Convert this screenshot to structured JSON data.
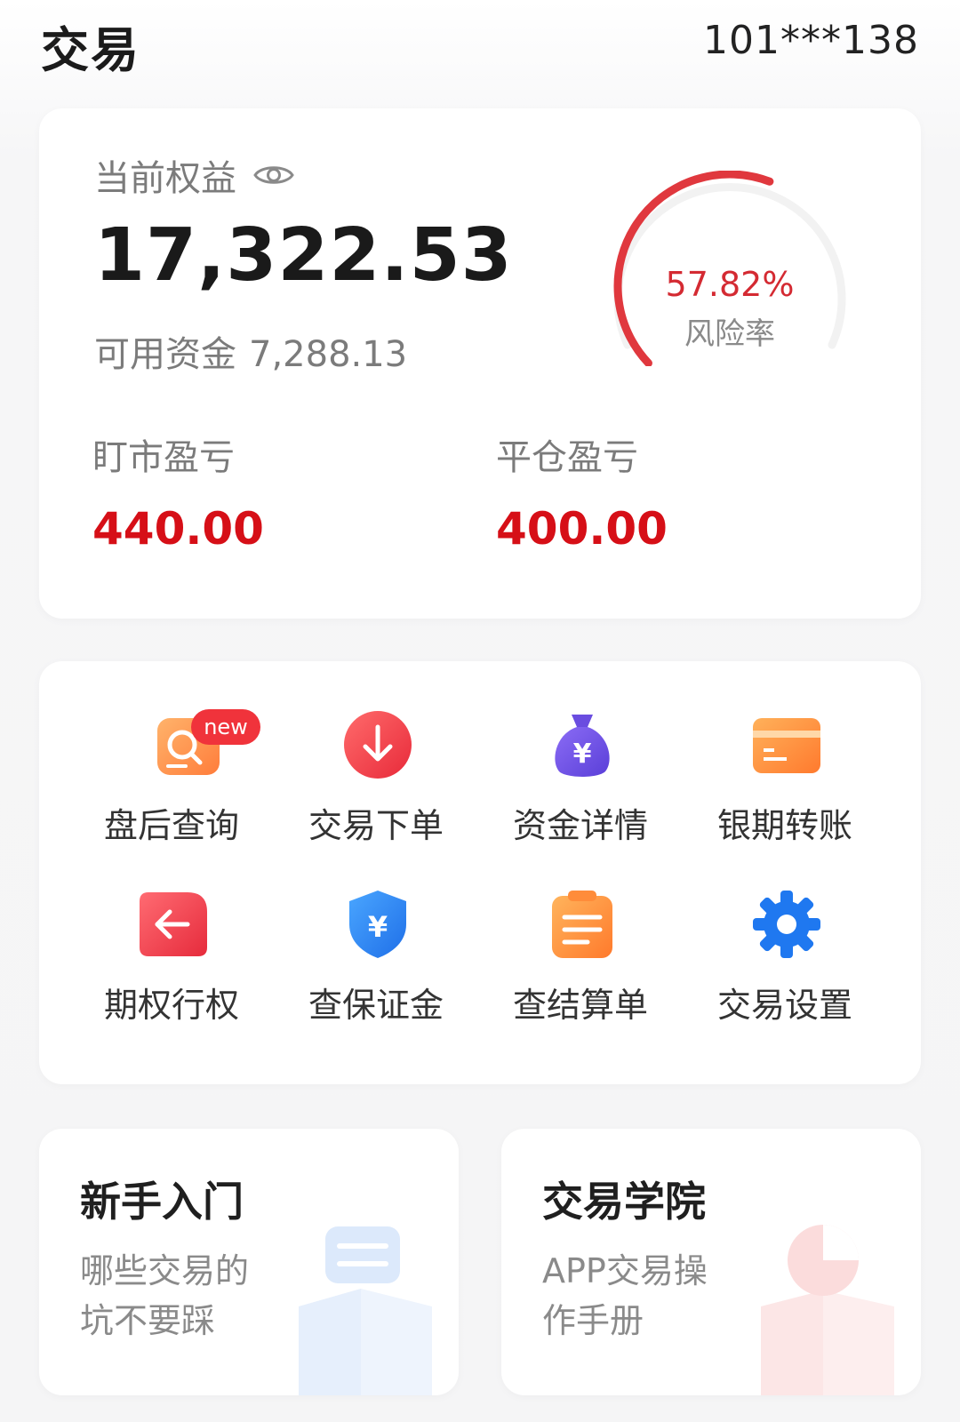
{
  "header": {
    "title": "交易",
    "account": "101***138"
  },
  "equity": {
    "label": "当前权益",
    "value": "17,322.53",
    "available_label": "可用资金",
    "available_value": "7,288.13",
    "risk_value": "57.82%",
    "risk_label": "风险率",
    "risk_fraction": 0.5782,
    "floating_pnl_label": "盯市盈亏",
    "floating_pnl_value": "440.00",
    "close_pnl_label": "平仓盈亏",
    "close_pnl_value": "400.00"
  },
  "menu": [
    {
      "label": "盘后查询",
      "icon": "search-doc-icon",
      "badge": "new"
    },
    {
      "label": "交易下单",
      "icon": "download-arrow-icon"
    },
    {
      "label": "资金详情",
      "icon": "money-bag-icon"
    },
    {
      "label": "银期转账",
      "icon": "bank-card-icon"
    },
    {
      "label": "期权行权",
      "icon": "back-arrow-icon"
    },
    {
      "label": "查保证金",
      "icon": "yuan-shield-icon"
    },
    {
      "label": "查结算单",
      "icon": "clipboard-icon"
    },
    {
      "label": "交易设置",
      "icon": "gear-icon"
    }
  ],
  "promos": [
    {
      "title": "新手入门",
      "desc_line1": "哪些交易的",
      "desc_line2": "坑不要踩"
    },
    {
      "title": "交易学院",
      "desc_line1": "APP交易操",
      "desc_line2": "作手册"
    }
  ],
  "colors": {
    "accent_red": "#d60f17",
    "risk_red": "#e0383e",
    "text_gray": "#7b7b7b"
  }
}
